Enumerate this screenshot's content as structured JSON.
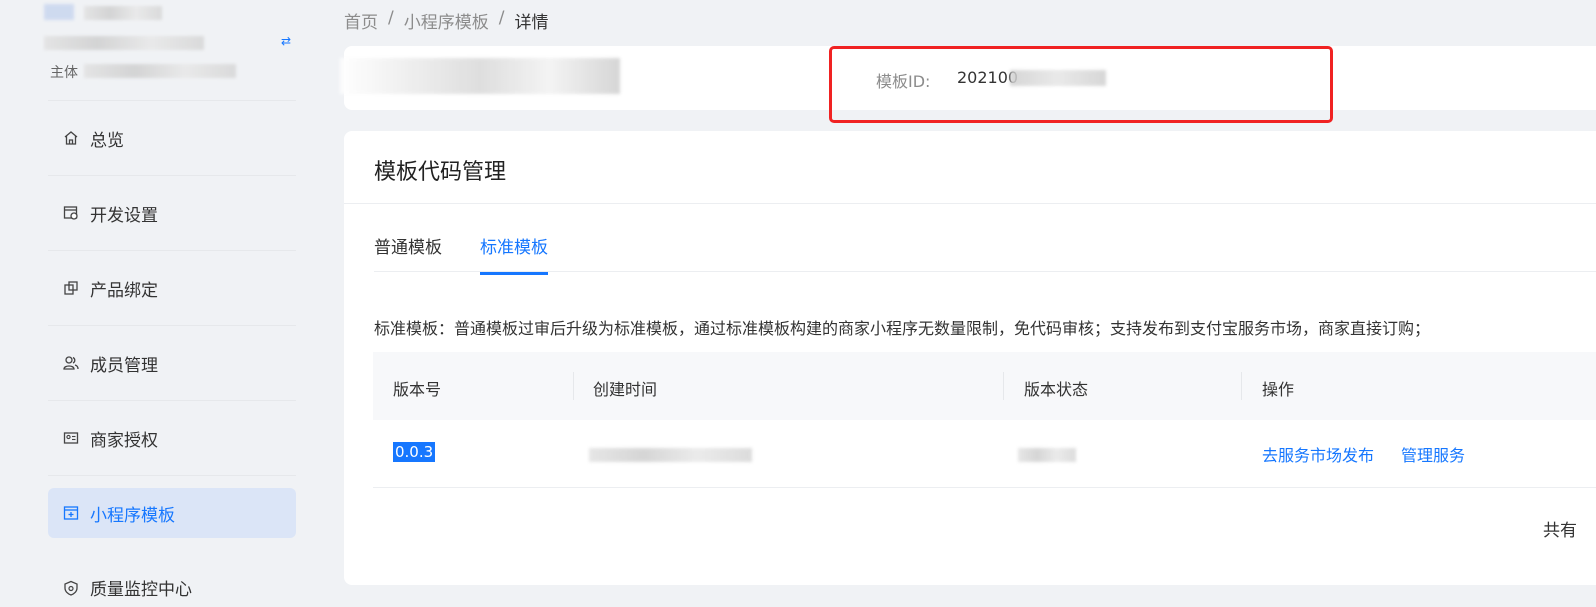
{
  "sidebar": {
    "account_subject_prefix": "主体",
    "items": [
      {
        "label": "总览",
        "icon": "home-icon"
      },
      {
        "label": "开发设置",
        "icon": "settings-window-icon"
      },
      {
        "label": "产品绑定",
        "icon": "link-squares-icon"
      },
      {
        "label": "成员管理",
        "icon": "users-icon"
      },
      {
        "label": "商家授权",
        "icon": "id-card-icon"
      },
      {
        "label": "小程序模板",
        "icon": "template-plus-icon",
        "active": true
      },
      {
        "label": "质量监控中心",
        "icon": "shield-icon"
      }
    ]
  },
  "breadcrumb": {
    "home": "首页",
    "sep": "/",
    "templates": "小程序模板",
    "current": "详情"
  },
  "info": {
    "id_label": "模板ID:",
    "id_value": "202100"
  },
  "card": {
    "title": "模板代码管理",
    "tabs": [
      {
        "label": "普通模板",
        "active": false
      },
      {
        "label": "标准模板",
        "active": true
      }
    ],
    "description": "标准模板：普通模板过审后升级为标准模板，通过标准模板构建的商家小程序无数量限制，免代码审核；支持发布到支付宝服务市场，商家直接订购；"
  },
  "table": {
    "columns": [
      "版本号",
      "创建时间",
      "版本状态",
      "操作"
    ],
    "rows": [
      {
        "version": "0.0.3",
        "actions": [
          "去服务市场发布",
          "管理服务"
        ]
      }
    ]
  },
  "pagination": {
    "total_prefix": "共有"
  },
  "colors": {
    "accent": "#1677ff",
    "highlight_box": "#f02222",
    "active_nav_bg": "#dbe5f7"
  }
}
